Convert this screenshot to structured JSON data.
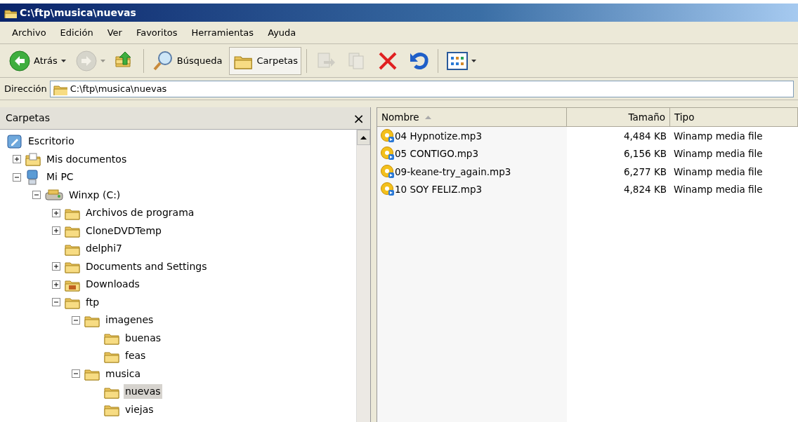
{
  "window": {
    "title": "C:\\ftp\\musica\\nuevas"
  },
  "menu": [
    "Archivo",
    "Edición",
    "Ver",
    "Favoritos",
    "Herramientas",
    "Ayuda"
  ],
  "toolbar": [
    {
      "kind": "back",
      "label": "Atrás",
      "dropdown": true,
      "disabled": false,
      "selected": false
    },
    {
      "kind": "forward",
      "dropdown": true,
      "disabled": true,
      "selected": false
    },
    {
      "kind": "up",
      "dropdown": false,
      "disabled": false,
      "selected": false
    },
    {
      "kind": "search",
      "label": "Búsqueda",
      "dropdown": false,
      "disabled": false,
      "selected": false
    },
    {
      "kind": "folders",
      "label": "Carpetas",
      "dropdown": false,
      "disabled": false,
      "selected": true
    },
    {
      "kind": "move",
      "dropdown": false,
      "disabled": true,
      "selected": false
    },
    {
      "kind": "copy",
      "dropdown": false,
      "disabled": true,
      "selected": false
    },
    {
      "kind": "delete",
      "dropdown": false,
      "disabled": false,
      "selected": false
    },
    {
      "kind": "undo",
      "dropdown": false,
      "disabled": false,
      "selected": false
    },
    {
      "kind": "views",
      "dropdown": true,
      "disabled": false,
      "selected": false
    }
  ],
  "address": {
    "label": "Dirección",
    "value": "C:\\ftp\\musica\\nuevas"
  },
  "folders_pane": {
    "title": "Carpetas",
    "close": "×",
    "tree": [
      {
        "label": "Escritorio",
        "kind": "desktop",
        "selected": false,
        "children": [
          {
            "label": "Mis documentos",
            "kind": "documents",
            "expandable": true,
            "expanded": false,
            "selected": false
          },
          {
            "label": "Mi PC",
            "kind": "computer",
            "expandable": true,
            "expanded": true,
            "selected": false,
            "children": [
              {
                "label": "Winxp (C:)",
                "kind": "drive",
                "expandable": true,
                "expanded": true,
                "selected": false,
                "children": [
                  {
                    "label": "Archivos de programa",
                    "kind": "folder",
                    "expandable": true,
                    "expanded": false,
                    "selected": false
                  },
                  {
                    "label": "CloneDVDTemp",
                    "kind": "folder",
                    "expandable": true,
                    "expanded": false,
                    "selected": false
                  },
                  {
                    "label": "delphi7",
                    "kind": "folder",
                    "expandable": false,
                    "selected": false
                  },
                  {
                    "label": "Documents and Settings",
                    "kind": "folder",
                    "expandable": true,
                    "expanded": false,
                    "selected": false
                  },
                  {
                    "label": "Downloads",
                    "kind": "downloads",
                    "expandable": true,
                    "expanded": false,
                    "selected": false
                  },
                  {
                    "label": "ftp",
                    "kind": "folder",
                    "expandable": true,
                    "expanded": true,
                    "selected": false,
                    "children": [
                      {
                        "label": "imagenes",
                        "kind": "folder",
                        "expandable": true,
                        "expanded": true,
                        "selected": false,
                        "children": [
                          {
                            "label": "buenas",
                            "kind": "folder",
                            "expandable": false,
                            "selected": false
                          },
                          {
                            "label": "feas",
                            "kind": "folder",
                            "expandable": false,
                            "selected": false
                          }
                        ]
                      },
                      {
                        "label": "musica",
                        "kind": "folder",
                        "expandable": true,
                        "expanded": true,
                        "selected": false,
                        "children": [
                          {
                            "label": "nuevas",
                            "kind": "folder",
                            "expandable": false,
                            "selected": true
                          },
                          {
                            "label": "viejas",
                            "kind": "folder",
                            "expandable": false,
                            "selected": false
                          }
                        ]
                      }
                    ]
                  }
                ]
              }
            ]
          }
        ]
      }
    ]
  },
  "files": {
    "columns": [
      {
        "label": "Nombre",
        "kind": "text",
        "sorted": true
      },
      {
        "label": "Tamaño",
        "kind": "number",
        "sorted": false
      },
      {
        "label": "Tipo",
        "kind": "text",
        "sorted": false
      }
    ],
    "rows": [
      {
        "name": "04 Hypnotize.mp3",
        "size": "4,484 KB",
        "type": "Winamp media file"
      },
      {
        "name": "05 CONTIGO.mp3",
        "size": "6,156 KB",
        "type": "Winamp media file"
      },
      {
        "name": "09-keane-try_again.mp3",
        "size": "6,277 KB",
        "type": "Winamp media file"
      },
      {
        "name": "10 SOY FELIZ.mp3",
        "size": "4,824 KB",
        "type": "Winamp media file"
      }
    ]
  }
}
